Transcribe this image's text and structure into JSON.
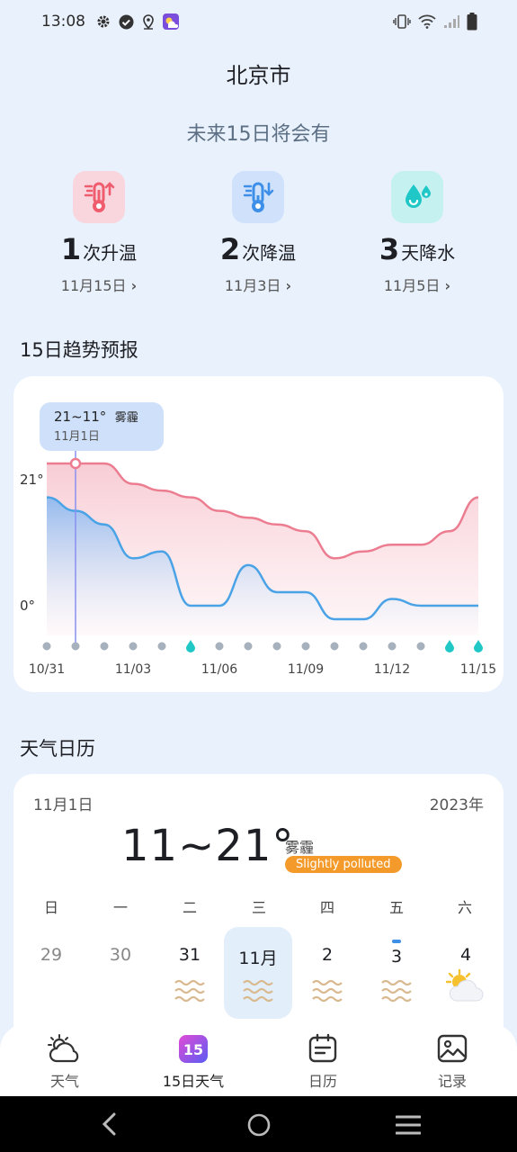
{
  "status": {
    "time": "13:08"
  },
  "header": {
    "city": "北京市"
  },
  "summary": {
    "title": "未来15日将会有",
    "items": [
      {
        "count": "1",
        "label": "次升温",
        "date": "11月15日",
        "icon": "thermometer-up-icon",
        "color": "#ee5c6e"
      },
      {
        "count": "2",
        "label": "次降温",
        "date": "11月3日",
        "icon": "thermometer-down-icon",
        "color": "#3e8fe8"
      },
      {
        "count": "3",
        "label": "天降水",
        "date": "11月5日",
        "icon": "water-drop-icon",
        "color": "#1fc7c7"
      }
    ]
  },
  "trend": {
    "title": "15日趋势预报",
    "tooltip": {
      "range": "21~11°",
      "condition": "雾霾",
      "date": "11月1日"
    },
    "y_labels": [
      "21°",
      "0°"
    ],
    "x_labels": [
      "10/31",
      "11/03",
      "11/06",
      "11/09",
      "11/12",
      "11/15"
    ]
  },
  "chart_data": {
    "type": "area",
    "x": [
      "10/31",
      "11/1",
      "11/2",
      "11/3",
      "11/4",
      "11/5",
      "11/6",
      "11/7",
      "11/8",
      "11/9",
      "11/10",
      "11/11",
      "11/12",
      "11/13",
      "11/14",
      "11/15"
    ],
    "series": [
      {
        "values": [
          21,
          21,
          21,
          18,
          17,
          16,
          14,
          13,
          12,
          11,
          7,
          8,
          9,
          9,
          11,
          16
        ]
      },
      {
        "values": [
          16,
          14,
          12,
          7,
          8,
          0,
          0,
          6,
          2,
          2,
          -2,
          -2,
          1,
          0,
          0,
          0
        ]
      }
    ],
    "precipitation_days": [
      "11/5",
      "11/14",
      "11/15"
    ],
    "y_ticks": [
      21,
      0
    ],
    "ylim": [
      -4,
      23
    ]
  },
  "calendar": {
    "title": "天气日历",
    "date": "11月1日",
    "year": "2023年",
    "temp": "11~21°",
    "condition": "雾霾",
    "aqi": "Slightly polluted",
    "weekdays": [
      "日",
      "一",
      "二",
      "三",
      "四",
      "五",
      "六"
    ],
    "days": [
      "29",
      "30",
      "31",
      "11月",
      "2",
      "3",
      "4"
    ]
  },
  "tabs": [
    {
      "label": "天气",
      "icon": "weather-cloud-icon"
    },
    {
      "label": "15日天气",
      "icon": "fifteen-day-icon",
      "badge": "15"
    },
    {
      "label": "日历",
      "icon": "calendar-icon"
    },
    {
      "label": "记录",
      "icon": "gallery-icon"
    }
  ]
}
